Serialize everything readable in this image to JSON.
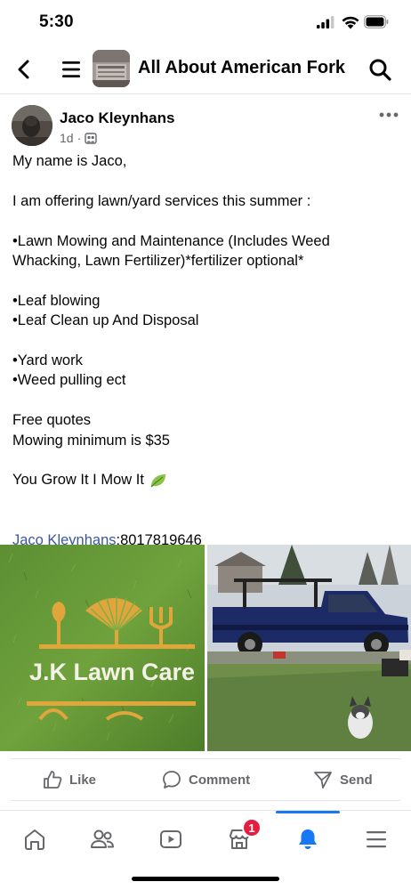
{
  "status_bar": {
    "time": "5:30"
  },
  "header": {
    "title": "All About American Fork"
  },
  "post": {
    "author": "Jaco Kleynhans",
    "time_ago": "1d",
    "meta_sep": "·",
    "lines": {
      "l1": "My name is Jaco,",
      "l2": "I am offering lawn/yard services this summer :",
      "l3": "•Lawn Mowing and Maintenance (Includes Weed Whacking, Lawn Fertilizer)*fertilizer optional*",
      "l4": "•Leaf blowing",
      "l5": "•Leaf Clean up And Disposal",
      "l6": "•Yard work",
      "l7": "•Weed pulling ect",
      "l8": "Free quotes",
      "l9": "Mowing minimum is $35",
      "l10": "You Grow It I Mow It"
    },
    "contact_name": "Jaco Kleynhans",
    "contact_phone": ":8017819646",
    "image_left_text": "J.K Lawn Care"
  },
  "actions": {
    "like": "Like",
    "comment": "Comment",
    "send": "Send"
  },
  "tabbar": {
    "notification_count": "1"
  },
  "colors": {
    "accent": "#1877f2",
    "link": "#385898",
    "badge": "#e41e3f",
    "muted": "#65676b"
  },
  "icons": [
    "back-icon",
    "menu-icon",
    "search-icon",
    "more-icon",
    "group-privacy-icon",
    "leaf-icon",
    "like-icon",
    "comment-icon",
    "send-icon",
    "home-icon",
    "friends-icon",
    "video-icon",
    "marketplace-icon",
    "bell-icon",
    "menu-tab-icon"
  ]
}
